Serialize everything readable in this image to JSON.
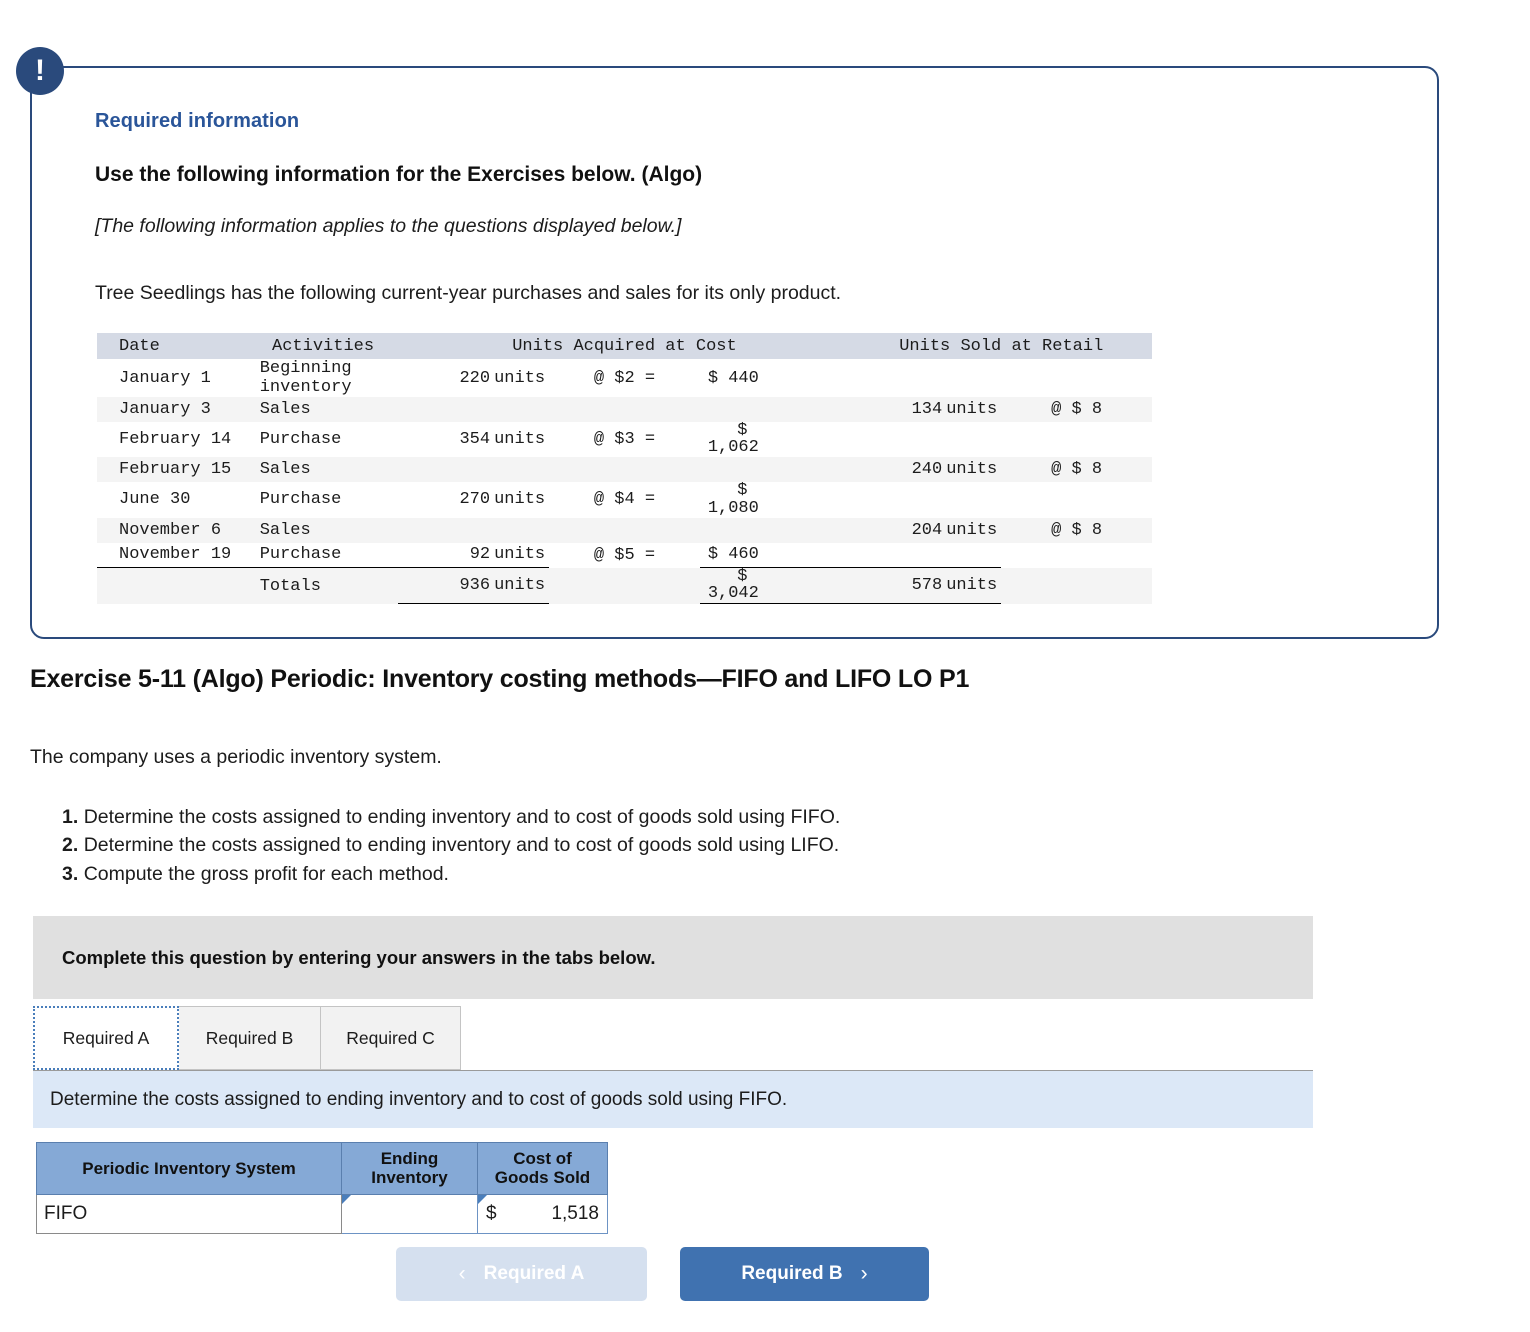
{
  "alert": {
    "icon": "exclamation-icon",
    "glyph": "!"
  },
  "required_info": {
    "label": "Required information",
    "heading": "Use the following information for the Exercises below. (Algo)",
    "italic_note": "[The following information applies to the questions displayed below.]",
    "intro": "Tree Seedlings has the following current-year purchases and sales for its only product."
  },
  "activity_table": {
    "headers": {
      "date": "Date",
      "activities": "Activities",
      "units_acquired": "Units Acquired at Cost",
      "units_sold": "Units Sold at Retail"
    },
    "rows": [
      {
        "date": "January 1",
        "activity": "Beginning inventory",
        "acq_units": "220 units",
        "at": "@ $2 =",
        "cost": "$ 440",
        "cost_stacked": false,
        "sold_units": "",
        "retail": ""
      },
      {
        "date": "January 3",
        "activity": "Sales",
        "acq_units": "",
        "at": "",
        "cost": "",
        "cost_stacked": false,
        "sold_units": "134 units",
        "retail": "@ $ 8"
      },
      {
        "date": "February 14",
        "activity": "Purchase",
        "acq_units": "354 units",
        "at": "@ $3 =",
        "cost": "1,062",
        "cost_stacked": true,
        "sold_units": "",
        "retail": ""
      },
      {
        "date": "February 15",
        "activity": "Sales",
        "acq_units": "",
        "at": "",
        "cost": "",
        "cost_stacked": false,
        "sold_units": "240 units",
        "retail": "@ $ 8"
      },
      {
        "date": "June 30",
        "activity": "Purchase",
        "acq_units": "270 units",
        "at": "@ $4 =",
        "cost": "1,080",
        "cost_stacked": true,
        "sold_units": "",
        "retail": ""
      },
      {
        "date": "November 6",
        "activity": "Sales",
        "acq_units": "",
        "at": "",
        "cost": "",
        "cost_stacked": false,
        "sold_units": "204 units",
        "retail": "@ $ 8"
      },
      {
        "date": "November 19",
        "activity": "Purchase",
        "acq_units": "92 units",
        "at": "@ $5 =",
        "cost": "$ 460",
        "cost_stacked": false,
        "sold_units": "",
        "retail": ""
      }
    ],
    "totals": {
      "activity": "Totals",
      "acq_units": "936 units",
      "cost": "3,042",
      "cost_symbol": "$",
      "sold_units": "578 units"
    },
    "dollar_symbol": "$"
  },
  "exercise": {
    "title": "Exercise 5-11 (Algo) Periodic: Inventory costing methods—FIFO and LIFO LO P1",
    "subtitle": "The company uses a periodic inventory system.",
    "requirements": [
      {
        "num": "1.",
        "text": "Determine the costs assigned to ending inventory and to cost of goods sold using FIFO."
      },
      {
        "num": "2.",
        "text": "Determine the costs assigned to ending inventory and to cost of goods sold using LIFO."
      },
      {
        "num": "3.",
        "text": "Compute the gross profit for each method."
      }
    ]
  },
  "complete_bar": {
    "text": "Complete this question by entering your answers in the tabs below."
  },
  "tabs": {
    "items": [
      {
        "label": "Required A",
        "active": true
      },
      {
        "label": "Required B",
        "active": false
      },
      {
        "label": "Required C",
        "active": false
      }
    ]
  },
  "prompt": {
    "text": "Determine the costs assigned to ending inventory and to cost of goods sold using FIFO."
  },
  "answer_table": {
    "headers": {
      "system": "Periodic Inventory System",
      "ending_inventory": "Ending Inventory",
      "ending_inventory_line1": "Ending",
      "ending_inventory_line2": "Inventory",
      "cogs_line1": "Cost of",
      "cogs_line2": "Goods Sold"
    },
    "rows": [
      {
        "method": "FIFO",
        "ending_inventory_symbol": "",
        "ending_inventory_value": "",
        "cogs_symbol": "$",
        "cogs_value": "1,518"
      }
    ]
  },
  "footer_nav": {
    "prev_label": "Required A",
    "prev_chevron": "‹",
    "next_label": "Required B",
    "next_chevron": "›"
  },
  "colors": {
    "brand_navy": "#2a4a7c",
    "link_blue": "#2a5599",
    "table_header": "#d5dae5",
    "row_shade": "#f4f4f4",
    "grey_bar": "#e0e0e0",
    "prompt_blue": "#dce8f7",
    "answer_header_blue": "#85a9d6",
    "btn_primary": "#4072b0",
    "btn_disabled": "#d5e0ef"
  }
}
